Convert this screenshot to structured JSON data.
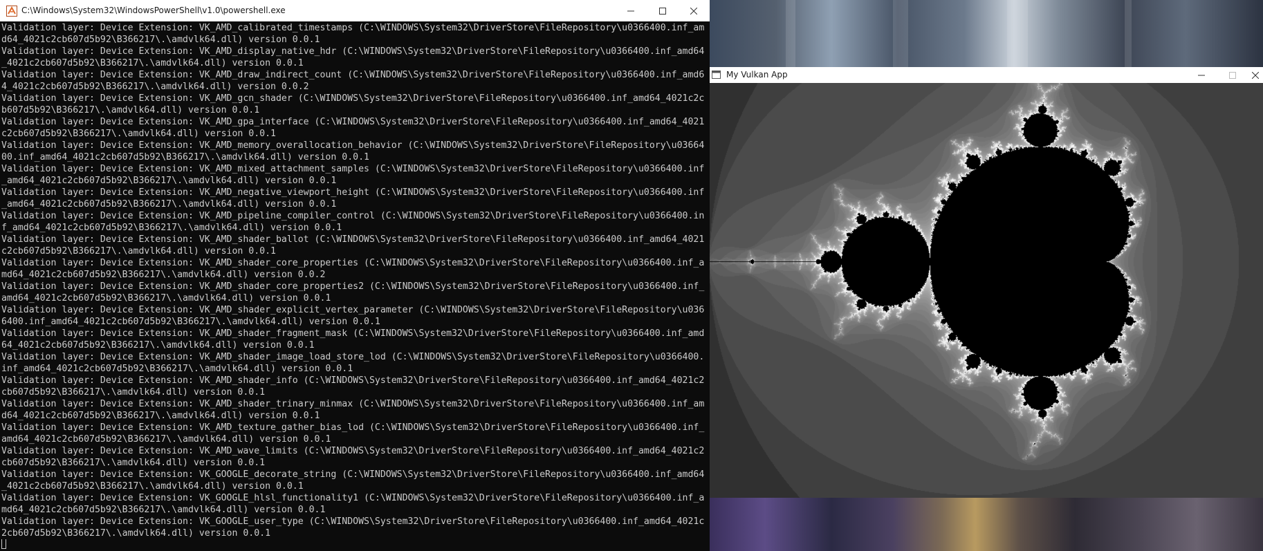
{
  "powershell": {
    "title": "C:\\Windows\\System32\\WindowsPowerShell\\v1.0\\powershell.exe",
    "lines": [
      "Validation layer: Device Extension: VK_AMD_calibrated_timestamps (C:\\WINDOWS\\System32\\DriverStore\\FileRepository\\u0366400.inf_am",
      "d64_4021c2cb607d5b92\\B366217\\.\\amdvlk64.dll) version 0.0.1",
      "Validation layer: Device Extension: VK_AMD_display_native_hdr (C:\\WINDOWS\\System32\\DriverStore\\FileRepository\\u0366400.inf_amd64",
      "_4021c2cb607d5b92\\B366217\\.\\amdvlk64.dll) version 0.0.1",
      "Validation layer: Device Extension: VK_AMD_draw_indirect_count (C:\\WINDOWS\\System32\\DriverStore\\FileRepository\\u0366400.inf_amd6",
      "4_4021c2cb607d5b92\\B366217\\.\\amdvlk64.dll) version 0.0.2",
      "Validation layer: Device Extension: VK_AMD_gcn_shader (C:\\WINDOWS\\System32\\DriverStore\\FileRepository\\u0366400.inf_amd64_4021c2c",
      "b607d5b92\\B366217\\.\\amdvlk64.dll) version 0.0.1",
      "Validation layer: Device Extension: VK_AMD_gpa_interface (C:\\WINDOWS\\System32\\DriverStore\\FileRepository\\u0366400.inf_amd64_4021",
      "c2cb607d5b92\\B366217\\.\\amdvlk64.dll) version 0.0.1",
      "Validation layer: Device Extension: VK_AMD_memory_overallocation_behavior (C:\\WINDOWS\\System32\\DriverStore\\FileRepository\\u03664",
      "00.inf_amd64_4021c2cb607d5b92\\B366217\\.\\amdvlk64.dll) version 0.0.1",
      "Validation layer: Device Extension: VK_AMD_mixed_attachment_samples (C:\\WINDOWS\\System32\\DriverStore\\FileRepository\\u0366400.inf",
      "_amd64_4021c2cb607d5b92\\B366217\\.\\amdvlk64.dll) version 0.0.1",
      "Validation layer: Device Extension: VK_AMD_negative_viewport_height (C:\\WINDOWS\\System32\\DriverStore\\FileRepository\\u0366400.inf",
      "_amd64_4021c2cb607d5b92\\B366217\\.\\amdvlk64.dll) version 0.0.1",
      "Validation layer: Device Extension: VK_AMD_pipeline_compiler_control (C:\\WINDOWS\\System32\\DriverStore\\FileRepository\\u0366400.in",
      "f_amd64_4021c2cb607d5b92\\B366217\\.\\amdvlk64.dll) version 0.0.1",
      "Validation layer: Device Extension: VK_AMD_shader_ballot (C:\\WINDOWS\\System32\\DriverStore\\FileRepository\\u0366400.inf_amd64_4021",
      "c2cb607d5b92\\B366217\\.\\amdvlk64.dll) version 0.0.1",
      "Validation layer: Device Extension: VK_AMD_shader_core_properties (C:\\WINDOWS\\System32\\DriverStore\\FileRepository\\u0366400.inf_a",
      "md64_4021c2cb607d5b92\\B366217\\.\\amdvlk64.dll) version 0.0.2",
      "Validation layer: Device Extension: VK_AMD_shader_core_properties2 (C:\\WINDOWS\\System32\\DriverStore\\FileRepository\\u0366400.inf_",
      "amd64_4021c2cb607d5b92\\B366217\\.\\amdvlk64.dll) version 0.0.1",
      "Validation layer: Device Extension: VK_AMD_shader_explicit_vertex_parameter (C:\\WINDOWS\\System32\\DriverStore\\FileRepository\\u036",
      "6400.inf_amd64_4021c2cb607d5b92\\B366217\\.\\amdvlk64.dll) version 0.0.1",
      "Validation layer: Device Extension: VK_AMD_shader_fragment_mask (C:\\WINDOWS\\System32\\DriverStore\\FileRepository\\u0366400.inf_amd",
      "64_4021c2cb607d5b92\\B366217\\.\\amdvlk64.dll) version 0.0.1",
      "Validation layer: Device Extension: VK_AMD_shader_image_load_store_lod (C:\\WINDOWS\\System32\\DriverStore\\FileRepository\\u0366400.",
      "inf_amd64_4021c2cb607d5b92\\B366217\\.\\amdvlk64.dll) version 0.0.1",
      "Validation layer: Device Extension: VK_AMD_shader_info (C:\\WINDOWS\\System32\\DriverStore\\FileRepository\\u0366400.inf_amd64_4021c2",
      "cb607d5b92\\B366217\\.\\amdvlk64.dll) version 0.0.1",
      "Validation layer: Device Extension: VK_AMD_shader_trinary_minmax (C:\\WINDOWS\\System32\\DriverStore\\FileRepository\\u0366400.inf_am",
      "d64_4021c2cb607d5b92\\B366217\\.\\amdvlk64.dll) version 0.0.1",
      "Validation layer: Device Extension: VK_AMD_texture_gather_bias_lod (C:\\WINDOWS\\System32\\DriverStore\\FileRepository\\u0366400.inf_",
      "amd64_4021c2cb607d5b92\\B366217\\.\\amdvlk64.dll) version 0.0.1",
      "Validation layer: Device Extension: VK_AMD_wave_limits (C:\\WINDOWS\\System32\\DriverStore\\FileRepository\\u0366400.inf_amd64_4021c2",
      "cb607d5b92\\B366217\\.\\amdvlk64.dll) version 0.0.1",
      "Validation layer: Device Extension: VK_GOOGLE_decorate_string (C:\\WINDOWS\\System32\\DriverStore\\FileRepository\\u0366400.inf_amd64",
      "_4021c2cb607d5b92\\B366217\\.\\amdvlk64.dll) version 0.0.1",
      "Validation layer: Device Extension: VK_GOOGLE_hlsl_functionality1 (C:\\WINDOWS\\System32\\DriverStore\\FileRepository\\u0366400.inf_a",
      "md64_4021c2cb607d5b92\\B366217\\.\\amdvlk64.dll) version 0.0.1",
      "Validation layer: Device Extension: VK_GOOGLE_user_type (C:\\WINDOWS\\System32\\DriverStore\\FileRepository\\u0366400.inf_amd64_4021c",
      "2cb607d5b92\\B366217\\.\\amdvlk64.dll) version 0.0.1"
    ]
  },
  "vulkan_app": {
    "title": "My Vulkan App"
  },
  "colors": {
    "console_bg": "#0c0c0c",
    "console_text": "#cccccc",
    "titlebar_bg": "#ffffff",
    "fractal_bg": "#0b0b0b"
  },
  "icons": {
    "powershell_icon": "powershell-app-icon",
    "vulkan_icon": "window-app-icon",
    "minimize": "minimize-icon",
    "maximize": "maximize-icon",
    "close": "close-icon"
  }
}
